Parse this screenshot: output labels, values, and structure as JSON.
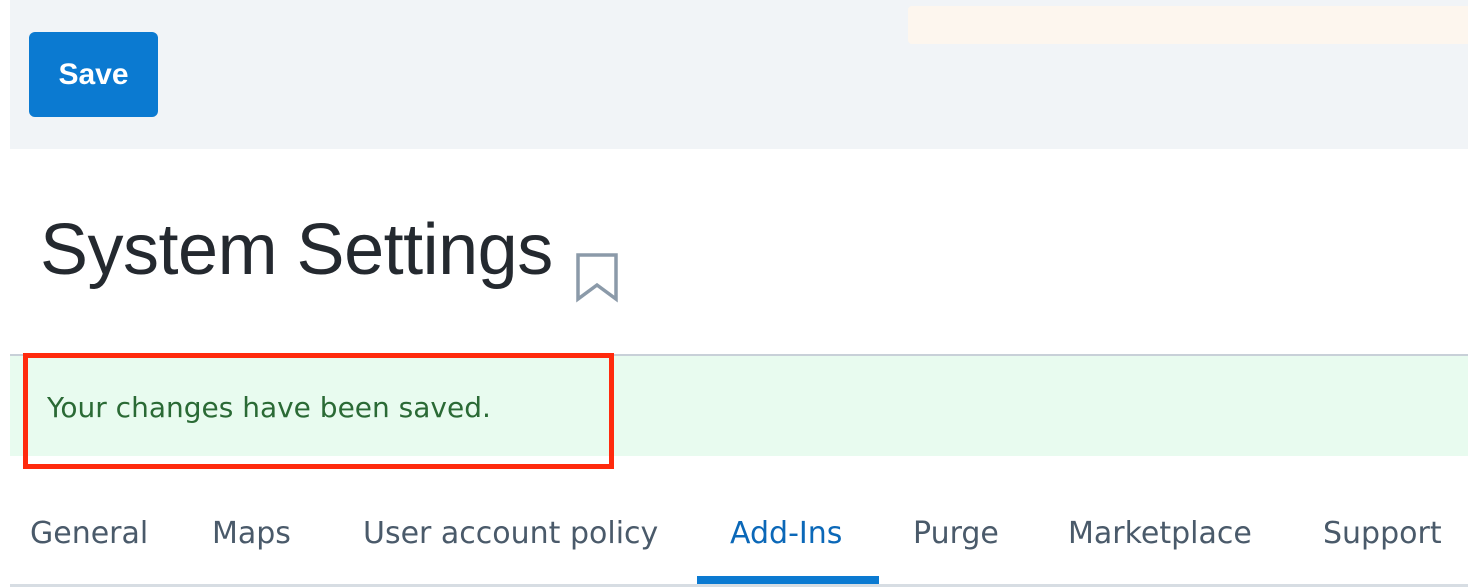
{
  "toolbar": {
    "save_label": "Save"
  },
  "header": {
    "title": "System Settings",
    "bookmark_icon": "bookmark-icon"
  },
  "banner": {
    "message": "Your changes have been saved.",
    "status": "success",
    "highlight_color": "#ff2a0d"
  },
  "tabs": [
    {
      "label": "General",
      "active": false
    },
    {
      "label": "Maps",
      "active": false
    },
    {
      "label": "User account policy",
      "active": false
    },
    {
      "label": "Add-Ins",
      "active": true
    },
    {
      "label": "Purge",
      "active": false
    },
    {
      "label": "Marketplace",
      "active": false
    },
    {
      "label": "Support",
      "active": false
    }
  ],
  "colors": {
    "accent": "#0b7ad1",
    "success_bg": "#e8fbef",
    "success_text": "#2a6a35",
    "toolbar_bg": "#f1f4f7"
  }
}
